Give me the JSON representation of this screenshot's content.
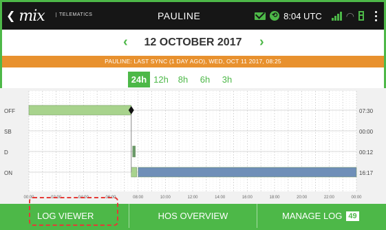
{
  "header": {
    "logo_text": "mix",
    "logo_subtext": "TELEMATICS",
    "title": "PAULINE",
    "time": "8:04 UTC"
  },
  "date_nav": {
    "date": "12 OCTOBER 2017",
    "prev_icon": "chevron-left-icon",
    "next_icon": "chevron-right-icon"
  },
  "sync_banner": "PAULINE: LAST SYNC (1 DAY AGO), WED, OCT 11 2017, 08:25",
  "range": {
    "options": [
      "24h",
      "12h",
      "8h",
      "6h",
      "3h"
    ],
    "active": "24h"
  },
  "chart_data": {
    "type": "timeline",
    "rows": [
      "OFF",
      "SB",
      "D",
      "ON"
    ],
    "x_ticks": [
      "00:00",
      "02:00",
      "04:00",
      "06:00",
      "08:00",
      "10:00",
      "12:00",
      "14:00",
      "16:00",
      "18:00",
      "20:00",
      "22:00",
      "00:00"
    ],
    "totals": [
      "07:30",
      "00:00",
      "00:12",
      "16:17"
    ],
    "x_range_hours": [
      0,
      24
    ],
    "segments": [
      {
        "status": "OFF",
        "start": 0,
        "end": 7.5,
        "color": "#a8d38d"
      },
      {
        "status": "ON",
        "start": 7.5,
        "end": 7.9,
        "color": "#a8d38d"
      },
      {
        "status": "D",
        "start": 7.6,
        "end": 7.8,
        "color": "#6a9a6a"
      },
      {
        "status": "ON",
        "start": 8.0,
        "end": 24,
        "color": "#6f8fb8"
      }
    ],
    "marker_hour": 7.5,
    "grid": true
  },
  "bottom_nav": {
    "log_viewer": "LOG VIEWER",
    "hos_overview": "HOS OVERVIEW",
    "manage_log": "MANAGE LOG",
    "manage_log_badge": "49"
  }
}
